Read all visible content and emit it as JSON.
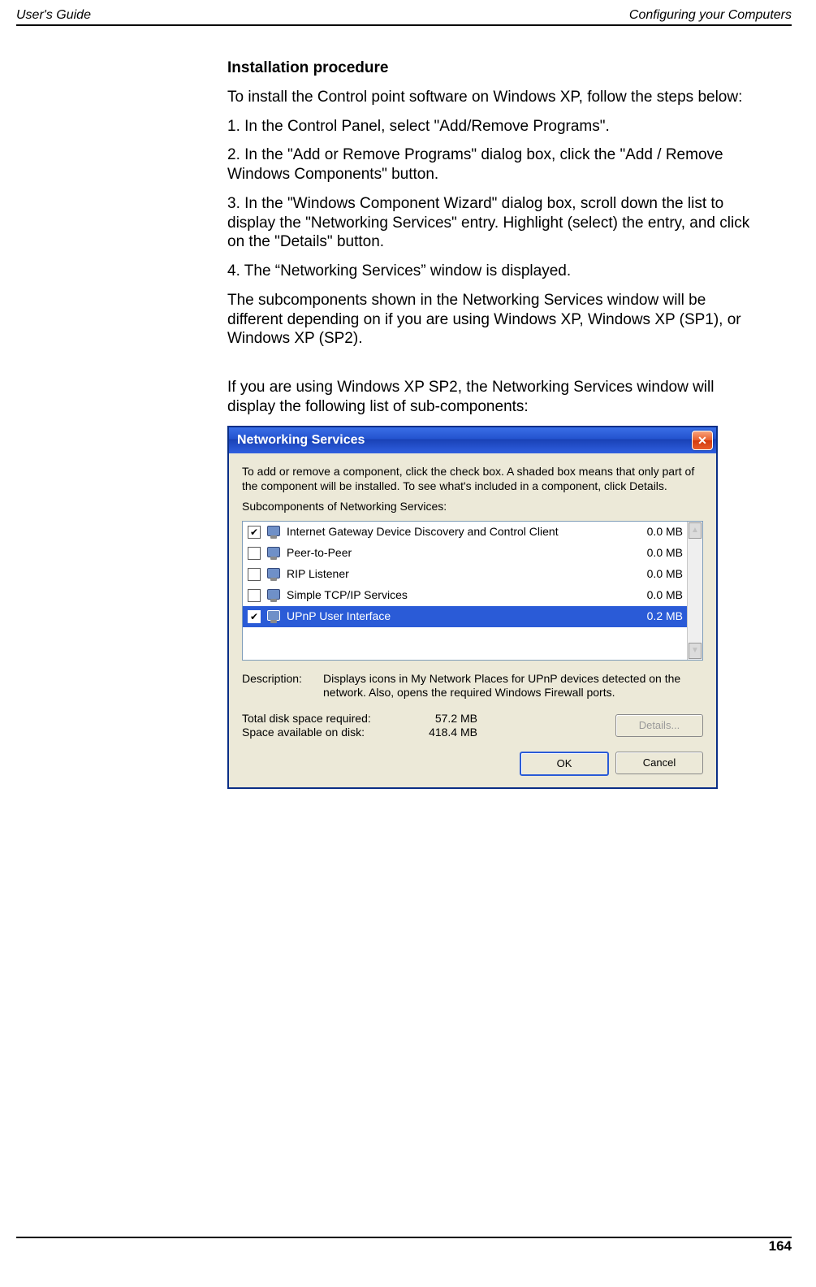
{
  "header": {
    "left": "User's Guide",
    "right": "Configuring your Computers"
  },
  "section_title": "Installation procedure",
  "paragraphs": {
    "intro": "To install the Control point software on Windows XP, follow the steps below:",
    "s1": "1. In the Control Panel, select \"Add/Remove Programs\".",
    "s2": "2. In the \"Add or Remove Programs\" dialog box, click the \"Add / Remove Windows Components\" button.",
    "s3": "3. In the \"Windows Component Wizard\" dialog box, scroll down the list to display the \"Networking Services\" entry. Highlight (select) the entry, and click on the \"Details\" button.",
    "s4": "4. The “Networking Services” window is displayed.",
    "note": "The subcomponents shown in the Networking Services window will be different depending on if you are using Windows XP, Windows XP (SP1), or Windows XP (SP2).",
    "sp2": "If you are using Windows XP SP2, the Networking Services window will display the following list of sub-components:"
  },
  "dialog": {
    "title": "Networking Services",
    "instructions": "To add or remove a component, click the check box. A shaded box means that only part of the component will be installed. To see what's included in a component, click Details.",
    "subhead": "Subcomponents of Networking Services:",
    "rows": [
      {
        "checked": true,
        "label": "Internet Gateway Device Discovery and Control Client",
        "size": "0.0 MB",
        "selected": false
      },
      {
        "checked": false,
        "label": "Peer-to-Peer",
        "size": "0.0 MB",
        "selected": false
      },
      {
        "checked": false,
        "label": "RIP Listener",
        "size": "0.0 MB",
        "selected": false
      },
      {
        "checked": false,
        "label": "Simple TCP/IP Services",
        "size": "0.0 MB",
        "selected": false
      },
      {
        "checked": true,
        "label": "UPnP User Interface",
        "size": "0.2 MB",
        "selected": true
      }
    ],
    "desc_label": "Description:",
    "desc_text": "Displays icons in My Network Places for UPnP devices detected on the network. Also, opens the required Windows Firewall ports.",
    "total_label": "Total disk space required:",
    "total_value": "57.2 MB",
    "avail_label": "Space available on disk:",
    "avail_value": "418.4 MB",
    "details_btn": "Details...",
    "ok_btn": "OK",
    "cancel_btn": "Cancel"
  },
  "page_number": "164"
}
